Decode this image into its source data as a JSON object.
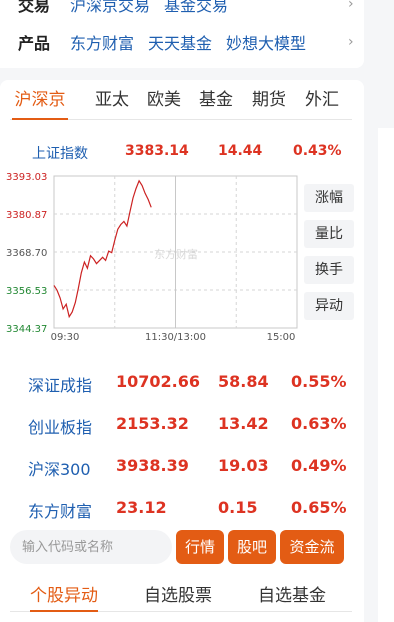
{
  "top": {
    "row1": {
      "label": "交易",
      "links": [
        "沪深京交易",
        "基金交易"
      ]
    },
    "row2": {
      "label": "产品",
      "links": [
        "东方财富",
        "天天基金",
        "妙想大模型"
      ]
    },
    "arrow": "›"
  },
  "tabs": [
    "沪深京",
    "亚太",
    "欧美",
    "基金",
    "期货",
    "外汇"
  ],
  "main_index": {
    "name": "上证指数",
    "value": "3383.14",
    "change": "14.44",
    "pct": "0.43%"
  },
  "chart_data": {
    "type": "line",
    "title": "",
    "y_ticks": [
      "3393.03",
      "3380.87",
      "3368.70",
      "3356.53",
      "3344.37"
    ],
    "ylim": [
      3344.37,
      3393.03
    ],
    "x_ticks": [
      "09:30",
      "11:30/13:00",
      "15:00"
    ],
    "watermark": "东方财富",
    "series": [
      {
        "values": [
          3358.0,
          3356.5,
          3354.0,
          3350.5,
          3352.0,
          3348.0,
          3349.5,
          3352.5,
          3357.0,
          3362.0,
          3365.5,
          3363.5,
          3367.5,
          3366.5,
          3365.0,
          3366.0,
          3367.0,
          3366.0,
          3369.0,
          3368.5,
          3372.5,
          3376.0,
          3377.5,
          3378.5,
          3377.0,
          3381.5,
          3386.0,
          3389.0,
          3391.5,
          3390.0,
          3387.5,
          3385.5,
          3383.0
        ]
      }
    ],
    "line_color": "#cc2222"
  },
  "side_buttons": [
    "涨幅",
    "量比",
    "换手",
    "异动"
  ],
  "indices": [
    {
      "name": "深证成指",
      "value": "10702.66",
      "change": "58.84",
      "pct": "0.55%"
    },
    {
      "name": "创业板指",
      "value": "2153.32",
      "change": "13.42",
      "pct": "0.63%"
    },
    {
      "name": "沪深300",
      "value": "3938.39",
      "change": "19.03",
      "pct": "0.49%"
    },
    {
      "name": "东方财富",
      "value": "23.12",
      "change": "0.15",
      "pct": "0.65%"
    }
  ],
  "search": {
    "placeholder": "输入代码或名称"
  },
  "action_buttons": [
    "行情",
    "股吧",
    "资金流"
  ],
  "bottom_tabs": [
    "个股异动",
    "自选股票",
    "自选基金"
  ],
  "colors": {
    "accent": "#e35c14",
    "up": "#dd3322",
    "link": "#1f5fb0"
  }
}
